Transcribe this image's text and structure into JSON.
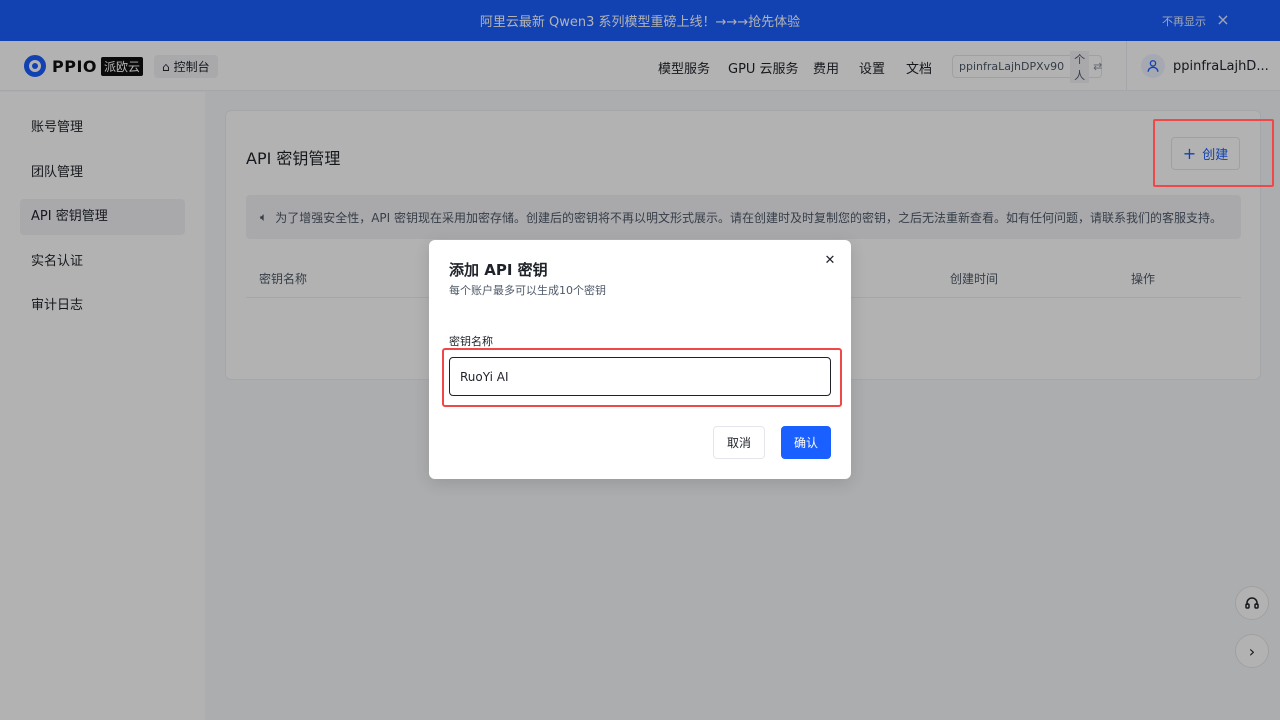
{
  "banner": {
    "text": "阿里云最新 Qwen3 系列模型重磅上线！→→→抢先体验",
    "hide_label": "不再显示",
    "close_icon": "×"
  },
  "header": {
    "logo_text": "PPIO",
    "logo_tag": "派欧云",
    "console_label": "控制台",
    "nav": [
      "模型服务",
      "GPU 云服务",
      "费用",
      "设置",
      "文档"
    ],
    "account_id": "ppinfraLajhDPXv90",
    "account_type": "个人",
    "username": "ppinfraLajhD..."
  },
  "sidebar": {
    "items": [
      "账号管理",
      "团队管理",
      "API 密钥管理",
      "实名认证",
      "审计日志"
    ],
    "active": "API 密钥管理"
  },
  "main": {
    "title": "API 密钥管理",
    "create_label": "创建",
    "notice": "为了增强安全性，API 密钥现在采用加密存储。创建后的密钥将不再以明文形式展示。请在创建时及时复制您的密钥，之后无法重新查看。如有任何问题，请联系我们的客服支持。",
    "columns": [
      "密钥名称",
      "创建时间",
      "操作"
    ]
  },
  "modal": {
    "title": "添加 API 密钥",
    "subtitle": "每个账户最多可以生成10个密钥",
    "field_label": "密钥名称",
    "field_value": "RuoYi AI",
    "cancel_label": "取消",
    "confirm_label": "确认"
  },
  "colors": {
    "primary": "#1a5fff",
    "highlight": "#f04848"
  },
  "icons": [
    "home-icon",
    "swap-icon",
    "user-icon",
    "plus-icon",
    "speaker-icon",
    "close-icon",
    "headset-icon",
    "chevron-right-icon"
  ]
}
